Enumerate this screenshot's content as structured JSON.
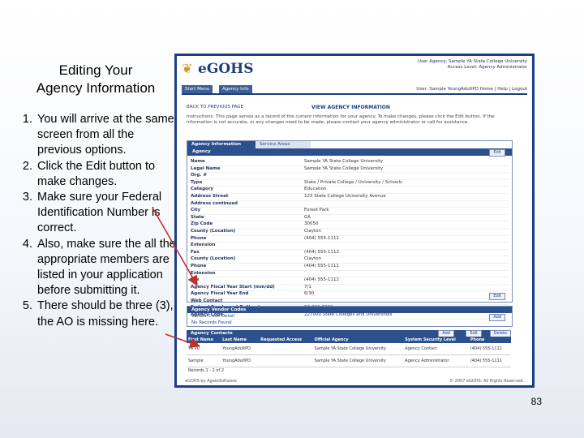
{
  "slide": {
    "title_line1": "Editing Your",
    "title_line2": "Agency Information",
    "steps": [
      "You will arrive at the same screen from all the previous options.",
      "Click the Edit button to make changes.",
      "Make sure your Federal Identification Number is correct.",
      "Also, make sure the all the appropriate members are listed in your application before submitting it.",
      "There should be three (3), the AO is missing here."
    ],
    "page_number": "83"
  },
  "app": {
    "logo": "eGOHS",
    "user_agency": "User Agency: Sample YA State College University",
    "access_level": "Access Level: Agency Administrator",
    "user_line": "User: Sample YoungAdultPD",
    "user_links": "Home | Help | Logout",
    "nav_tabs": [
      "Start Menu",
      "Agency Info"
    ],
    "back_link": "BACK TO PREVIOUS PAGE",
    "page_heading": "VIEW AGENCY INFORMATION",
    "instructions": "Instructions: This page serves as a record of the current information for your agency. To make changes, please click the Edit button. If the information is not accurate, or any changes need to be made, please contact your agency administrator or call for assistance.",
    "panel_tabs": [
      "Agency Information",
      "Service Areas"
    ],
    "panel_header": "Agency",
    "edit_label": "Edit",
    "fields": [
      {
        "label": "Name",
        "value": "Sample YA State College University"
      },
      {
        "label": "Legal Name",
        "value": "Sample YA State College University"
      },
      {
        "label": "Org. #",
        "value": ""
      },
      {
        "label": "Type",
        "value": "State / Private College / University / Schools"
      },
      {
        "label": "Category",
        "value": "Education"
      },
      {
        "label": "Address Street",
        "value": "123 State College University Avenue"
      },
      {
        "label": "Address continued",
        "value": ""
      },
      {
        "label": "City",
        "value": "Forest Park"
      },
      {
        "label": "State",
        "value": "GA"
      },
      {
        "label": "Zip Code",
        "value": "30050"
      },
      {
        "label": "County (Location)",
        "value": "Clayton"
      },
      {
        "label": "Phone",
        "value": "(404) 555-1111"
      },
      {
        "label": "Extension",
        "value": ""
      },
      {
        "label": "Fax",
        "value": "(404) 555-1112"
      },
      {
        "label": "County (Location)",
        "value": "Clayton"
      },
      {
        "label": "Phone",
        "value": "(404) 555-1111"
      },
      {
        "label": "Extension",
        "value": ""
      },
      {
        "label": "Fax",
        "value": "(404) 555-1112"
      },
      {
        "label": "Agency Fiscal Year Start (mm/dd)",
        "value": "7/1"
      },
      {
        "label": "Agency Fiscal Year End",
        "value": "6/30"
      },
      {
        "label": "Web Contact",
        "value": ""
      },
      {
        "label": "Federal Employer I.D. Number",
        "value": "58-000-0000"
      },
      {
        "label": "Agency Code",
        "value": "227000 State Colleges and Universities"
      }
    ],
    "vendor": {
      "header": "Agency Vendor Codes",
      "line1": "Vendor Code Detail",
      "line2": "No Records Found",
      "add_label": "Add"
    },
    "contacts": {
      "header": "Agency Contacts",
      "buttons": [
        "Add",
        "Edit",
        "Delete"
      ],
      "columns": [
        "First Name",
        "Last Name",
        "Requested Access",
        "Official Agency",
        "System Security Level",
        "Phone"
      ],
      "rows": [
        [
          "YA PD",
          "YoungAdultPD",
          "",
          "Sample YA State College University",
          "Agency Contact",
          "(404) 555-1111"
        ],
        [
          "Sample",
          "YoungAdultPD",
          "",
          "Sample YA State College University",
          "Agency Administrator",
          "(404) 555-1111"
        ]
      ],
      "records": "Records 1 - 2 of 2"
    },
    "footer_left": "eGOHS by AgateSoftware",
    "footer_right": "© 2007 eGOHS. All Rights Reserved."
  },
  "colors": {
    "frame": "#1a3f86",
    "header_blue": "#2c4f8e",
    "arrow": "#c0302a"
  }
}
